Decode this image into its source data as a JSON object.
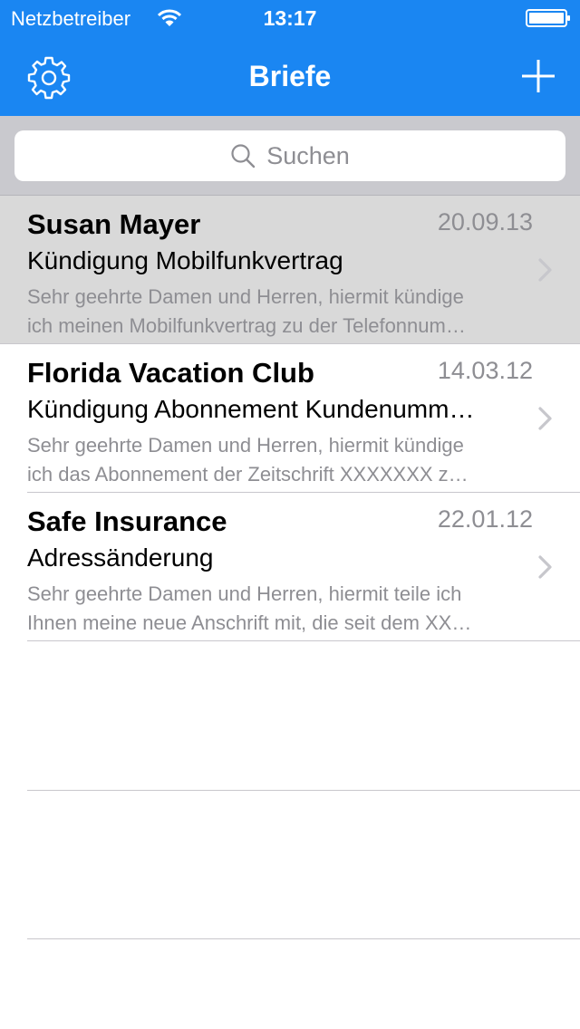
{
  "status_bar": {
    "carrier": "Netzbetreiber",
    "time": "13:17"
  },
  "nav": {
    "title": "Briefe",
    "left_icon": "gear-icon",
    "right_icon": "plus-icon"
  },
  "search": {
    "placeholder": "Suchen"
  },
  "letters": [
    {
      "sender": "Susan Mayer",
      "date": "20.09.13",
      "subject": "Kündigung Mobilfunkvertrag",
      "preview_line1": "Sehr geehrte Damen und Herren,  hiermit kündige",
      "preview_line2": "ich meinen Mobilfunkvertrag zu der Telefonnum…",
      "selected": true
    },
    {
      "sender": "Florida Vacation Club",
      "date": "14.03.12",
      "subject": "Kündigung Abonnement Kundenumm…",
      "preview_line1": "Sehr geehrte Damen und Herren,  hiermit kündige",
      "preview_line2": "ich das Abonnement der Zeitschrift XXXXXXX z…",
      "selected": false
    },
    {
      "sender": "Safe Insurance",
      "date": "22.01.12",
      "subject": "Adressänderung",
      "preview_line1": "Sehr geehrte Damen und Herren,  hiermit teile ich",
      "preview_line2": "Ihnen meine neue Anschrift mit, die seit dem XX…",
      "selected": false
    }
  ],
  "colors": {
    "accent": "#1a86f2",
    "selected_row": "#d9d9d9",
    "secondary_text": "#8e8e93"
  }
}
